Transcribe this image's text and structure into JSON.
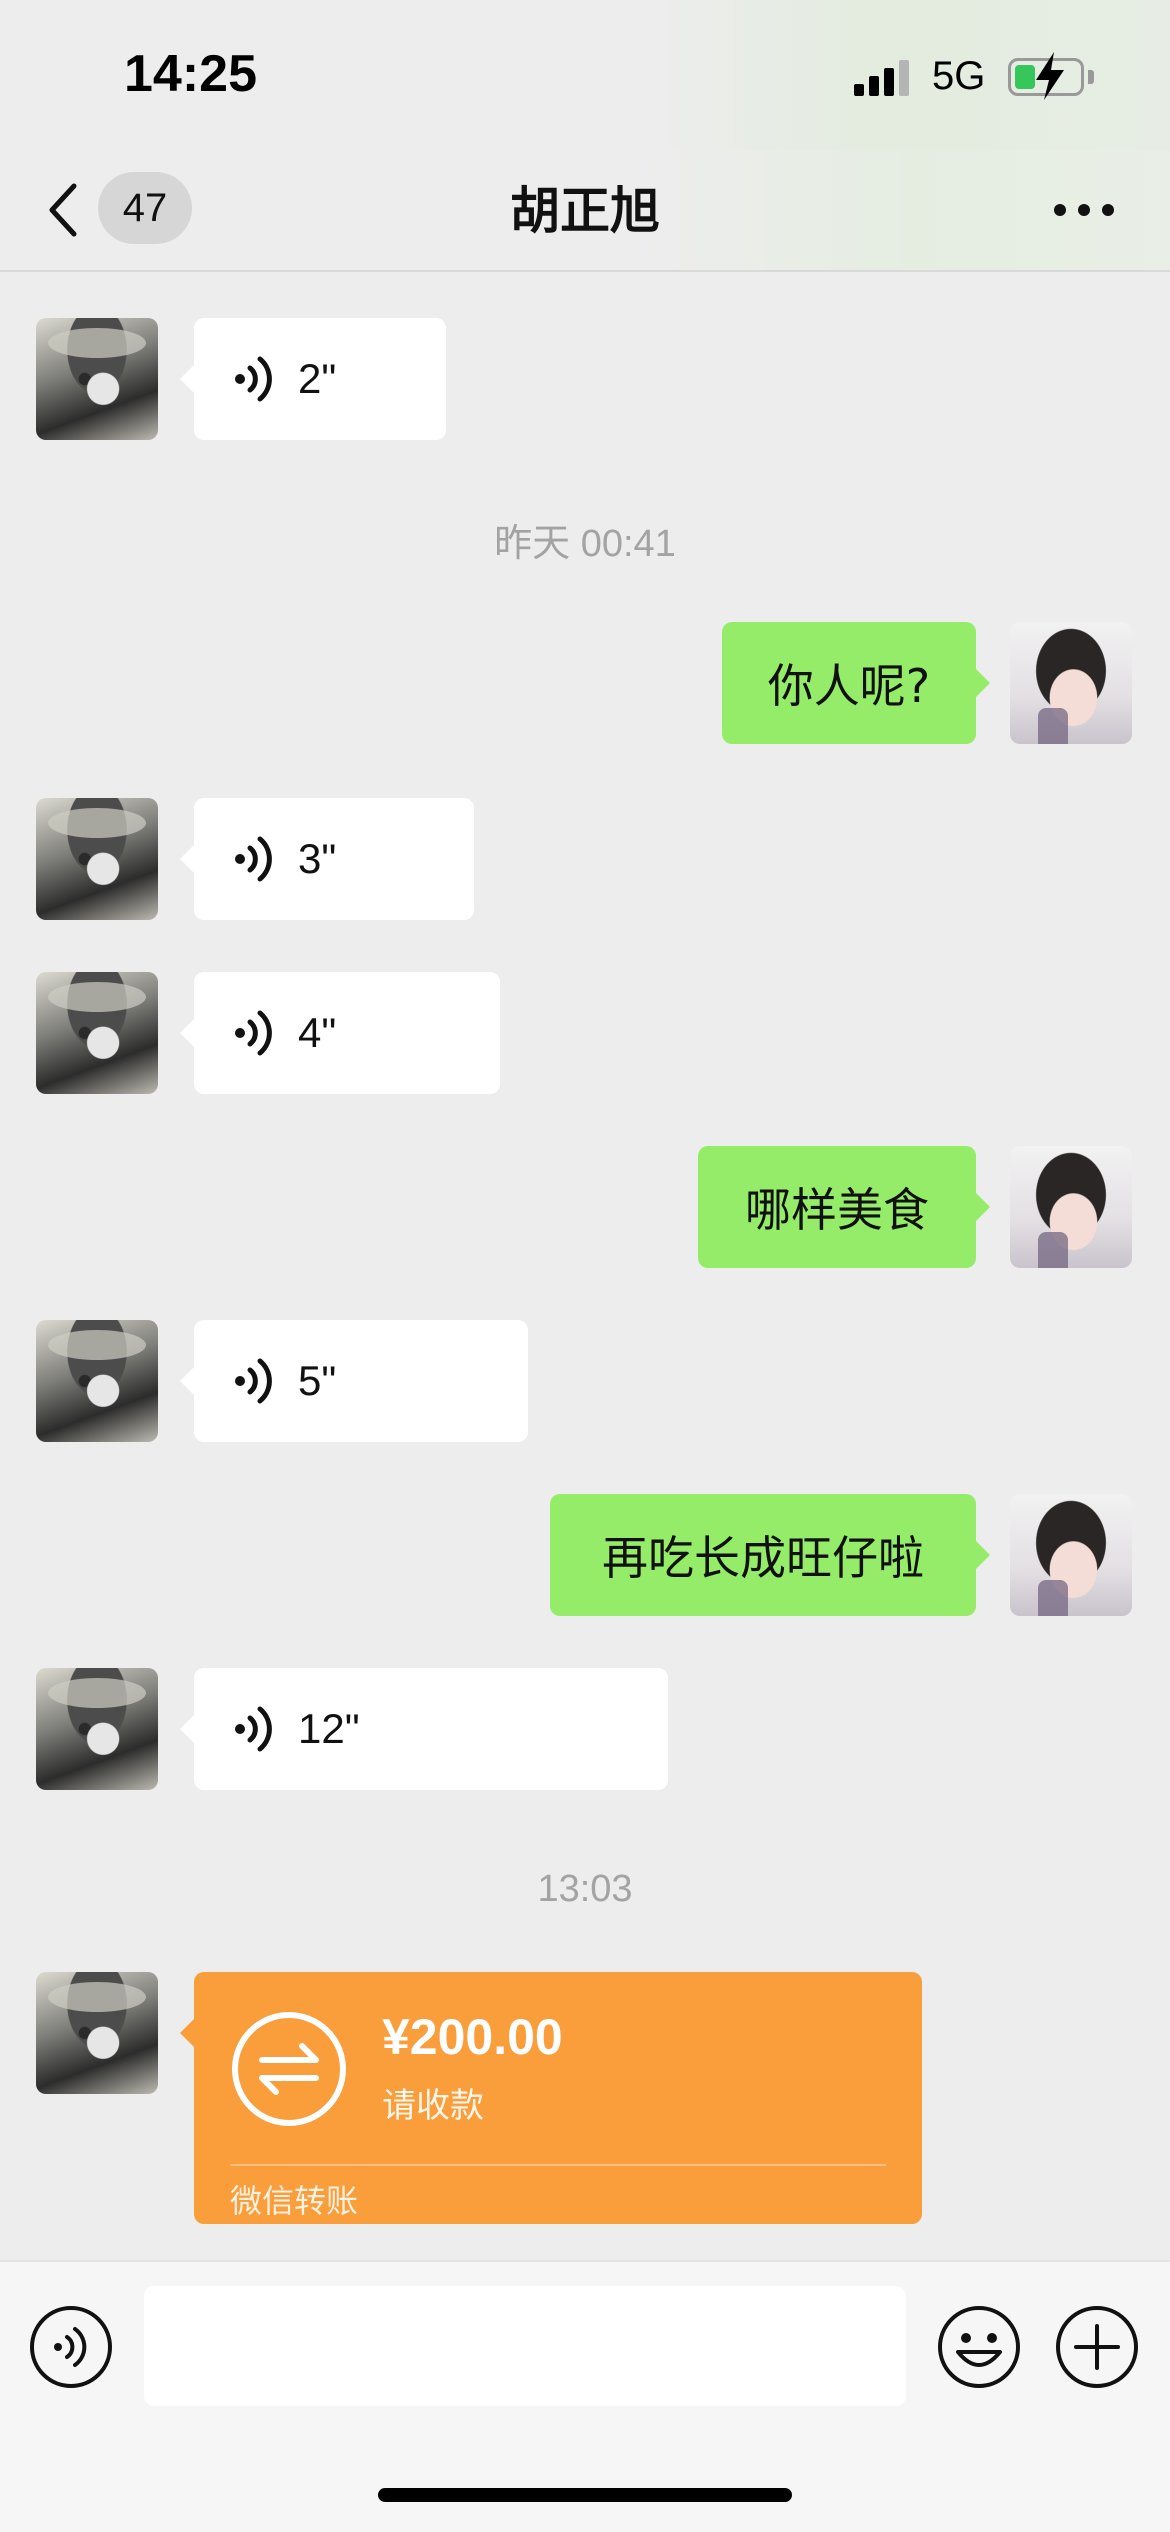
{
  "status_bar": {
    "time": "14:25",
    "network": "5G",
    "signal_icon": "signal-bars-icon",
    "battery_icon": "battery-charging-icon",
    "battery_color": "#35c759"
  },
  "nav": {
    "back_icon": "chevron-left-icon",
    "unread_count": "47",
    "title": "胡正旭",
    "more_icon": "ellipsis-icon"
  },
  "messages": [
    {
      "sender": "friend",
      "type": "voice",
      "duration": "2\""
    },
    {
      "type": "timestamp",
      "text": "昨天 00:41"
    },
    {
      "sender": "self",
      "type": "text",
      "text": "你人呢?"
    },
    {
      "sender": "friend",
      "type": "voice",
      "duration": "3\""
    },
    {
      "sender": "friend",
      "type": "voice",
      "duration": "4\""
    },
    {
      "sender": "self",
      "type": "text",
      "text": "哪样美食"
    },
    {
      "sender": "friend",
      "type": "voice",
      "duration": "5\""
    },
    {
      "sender": "self",
      "type": "text",
      "text": "再吃长成旺仔啦"
    },
    {
      "sender": "friend",
      "type": "voice",
      "duration": "12\""
    },
    {
      "type": "timestamp",
      "text": "13:03"
    },
    {
      "sender": "friend",
      "type": "transfer",
      "amount": "¥200.00",
      "status": "请收款",
      "source": "微信转账",
      "icon": "transfer-arrows-icon"
    }
  ],
  "colors": {
    "self_bubble": "#95ec69",
    "friend_bubble": "#ffffff",
    "transfer_card": "#fa9d3b",
    "background": "#ededed"
  },
  "input_bar": {
    "voice_icon": "voice-toggle-icon",
    "input_value": "",
    "emoji_icon": "emoji-icon",
    "plus_icon": "plus-icon"
  }
}
